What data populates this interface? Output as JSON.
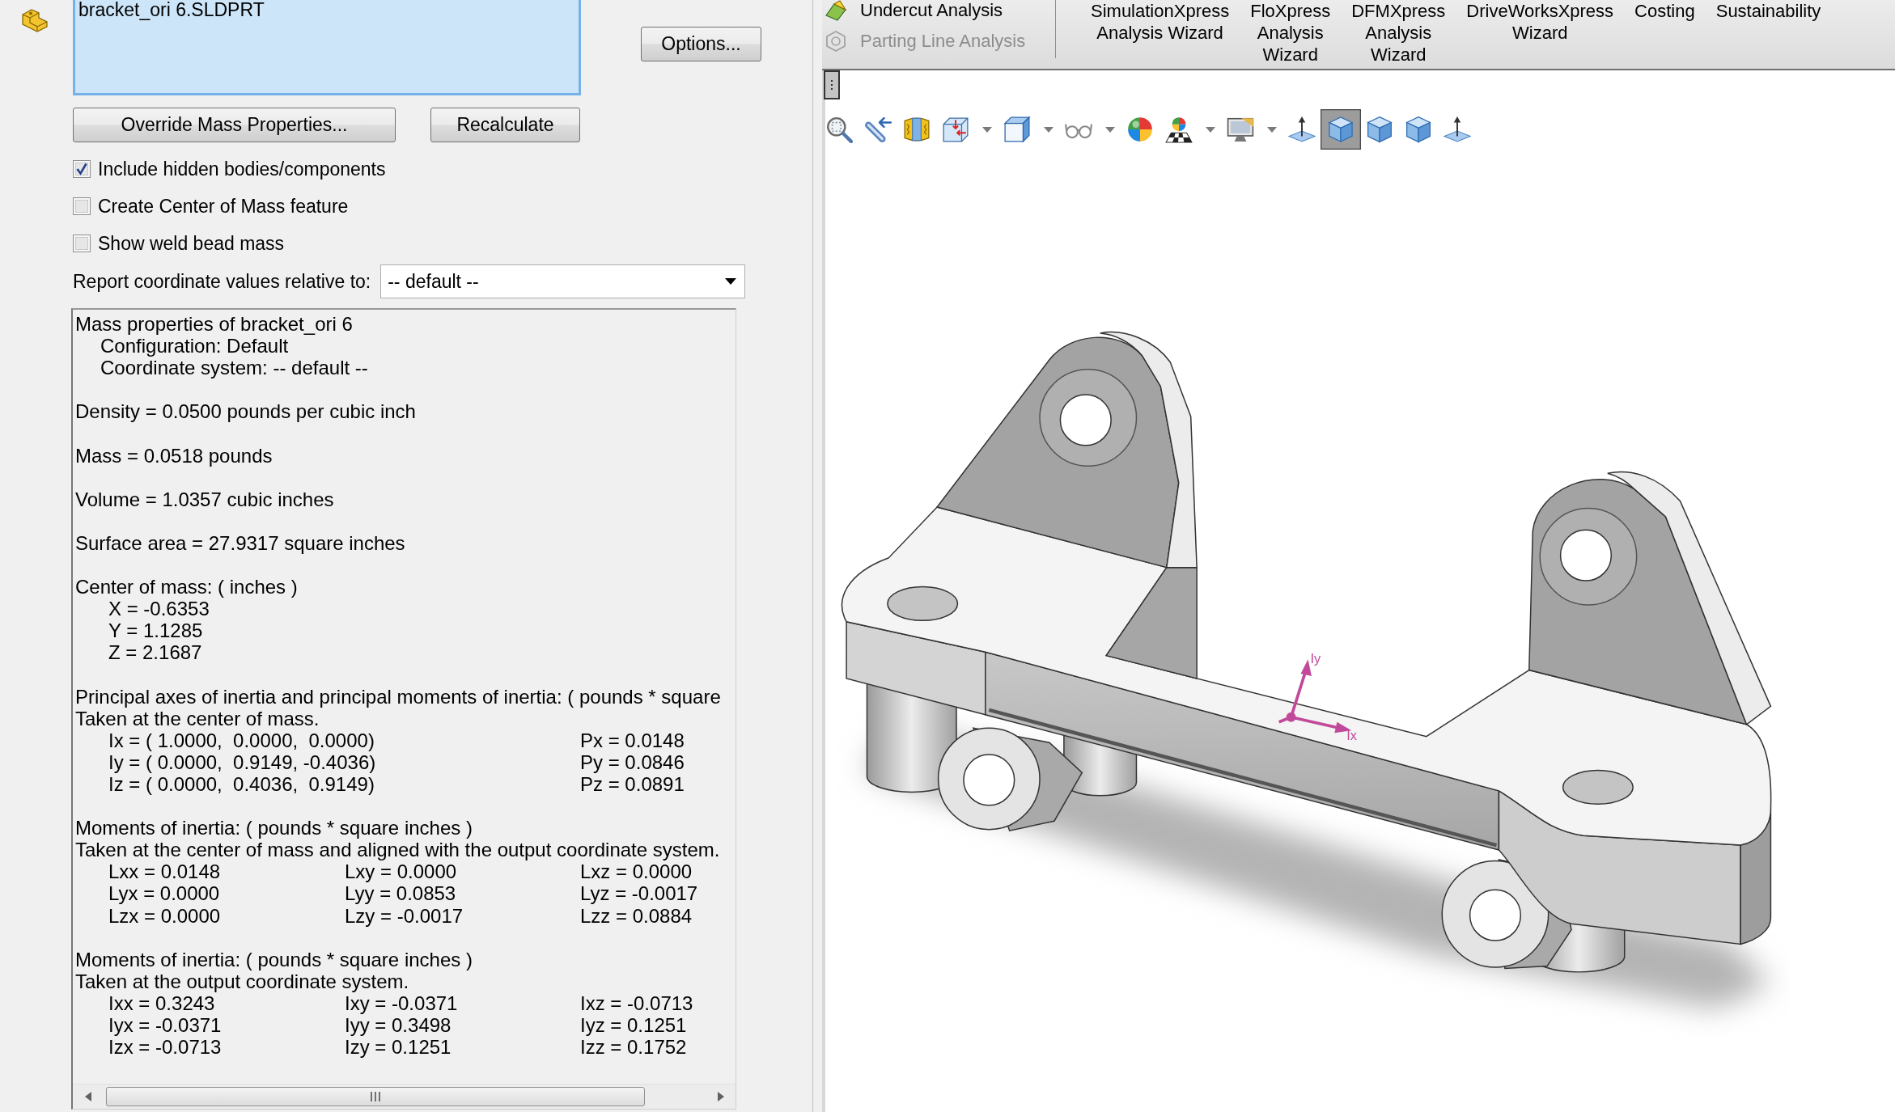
{
  "selection_list": {
    "items": [
      {
        "label": "bracket_ori 6.SLDPRT"
      }
    ]
  },
  "options_button": "Options...",
  "override_button": "Override Mass Properties...",
  "recalculate_button": "Recalculate",
  "checkboxes": [
    {
      "label": "Include hidden bodies/components",
      "checked": true
    },
    {
      "label": "Create Center of Mass feature",
      "checked": false
    },
    {
      "label": "Show weld bead mass",
      "checked": false
    }
  ],
  "coordinate_field": {
    "label": "Report coordinate values relative to:",
    "value": "-- default --"
  },
  "report": {
    "sections": [
      {
        "lines": [
          "Mass properties of bracket_ori 6"
        ],
        "details": [
          "Configuration: Default",
          "Coordinate system: -- default --"
        ]
      },
      {
        "lines": [
          "Density = 0.0500 pounds per cubic inch"
        ]
      },
      {
        "lines": [
          "Mass = 0.0518 pounds"
        ]
      },
      {
        "lines": [
          "Volume = 1.0357 cubic inches"
        ]
      },
      {
        "lines": [
          "Surface area = 27.9317 square inches"
        ]
      },
      {
        "lines": [
          "Center of mass: ( inches )"
        ],
        "rows": [
          [
            "X = -0.6353"
          ],
          [
            "Y = 1.1285"
          ],
          [
            "Z = 2.1687"
          ]
        ]
      },
      {
        "lines": [
          "Principal axes of inertia and principal moments of inertia: ( pounds * square",
          "Taken at the center of mass."
        ],
        "rows": [
          [
            "Ix = ( 1.0000,  0.0000,  0.0000)",
            "Px = 0.0148"
          ],
          [
            "Iy = ( 0.0000,  0.9149, -0.4036)",
            "Py = 0.0846"
          ],
          [
            "Iz = ( 0.0000,  0.4036,  0.9149)",
            "Pz = 0.0891"
          ]
        ]
      },
      {
        "lines": [
          "Moments of inertia: ( pounds * square inches )",
          "Taken at the center of mass and aligned with the output coordinate system."
        ],
        "rows": [
          [
            "Lxx = 0.0148",
            "Lxy = 0.0000",
            "Lxz = 0.0000"
          ],
          [
            "Lyx = 0.0000",
            "Lyy = 0.0853",
            "Lyz = -0.0017"
          ],
          [
            "Lzx = 0.0000",
            "Lzy = -0.0017",
            "Lzz = 0.0884"
          ]
        ]
      },
      {
        "lines": [
          "Moments of inertia: ( pounds * square inches )",
          "Taken at the output coordinate system."
        ],
        "rows": [
          [
            "Ixx = 0.3243",
            "Ixy = -0.0371",
            "Ixz = -0.0713"
          ],
          [
            "Iyx = -0.0371",
            "Iyy = 0.3498",
            "Iyz = 0.1251"
          ],
          [
            "Izx = -0.0713",
            "Izy = 0.1251",
            "Izz = 0.1752"
          ]
        ]
      }
    ]
  },
  "ribbon": {
    "tools": [
      {
        "kind": "undercut",
        "label": "Undercut Analysis",
        "disabled": false
      },
      {
        "kind": "parting",
        "label": "Parting Line Analysis",
        "disabled": true
      }
    ],
    "wizards": [
      {
        "lines": [
          "SimulationXpress",
          "Analysis Wizard"
        ]
      },
      {
        "lines": [
          "FloXpress",
          "Analysis",
          "Wizard"
        ]
      },
      {
        "lines": [
          "DFMXpress",
          "Analysis",
          "Wizard"
        ]
      },
      {
        "lines": [
          "DriveWorksXpress",
          "Wizard"
        ]
      },
      {
        "lines": [
          "Costing"
        ]
      },
      {
        "lines": [
          "Sustainability"
        ]
      }
    ]
  },
  "view_toolbar": [
    {
      "kind": "magnifier",
      "dropdown": false,
      "selected": false
    },
    {
      "kind": "tube",
      "dropdown": false,
      "selected": false
    },
    {
      "kind": "section",
      "dropdown": false,
      "selected": false
    },
    {
      "kind": "orient",
      "dropdown": true,
      "selected": false
    },
    {
      "kind": "display",
      "dropdown": true,
      "selected": false
    },
    {
      "kind": "glasses",
      "dropdown": true,
      "selected": false
    },
    {
      "kind": "sphere",
      "dropdown": false,
      "selected": false
    },
    {
      "kind": "scene",
      "dropdown": true,
      "selected": false
    },
    {
      "kind": "monitor",
      "dropdown": true,
      "selected": false
    },
    {
      "kind": "plane",
      "dropdown": false,
      "selected": false
    },
    {
      "kind": "cube",
      "dropdown": false,
      "selected": true
    },
    {
      "kind": "cube",
      "dropdown": false,
      "selected": false
    },
    {
      "kind": "cube",
      "dropdown": false,
      "selected": false
    },
    {
      "kind": "plane",
      "dropdown": false,
      "selected": false
    }
  ],
  "viewport": {
    "axis_labels": [
      "Iy",
      "Ix"
    ]
  }
}
